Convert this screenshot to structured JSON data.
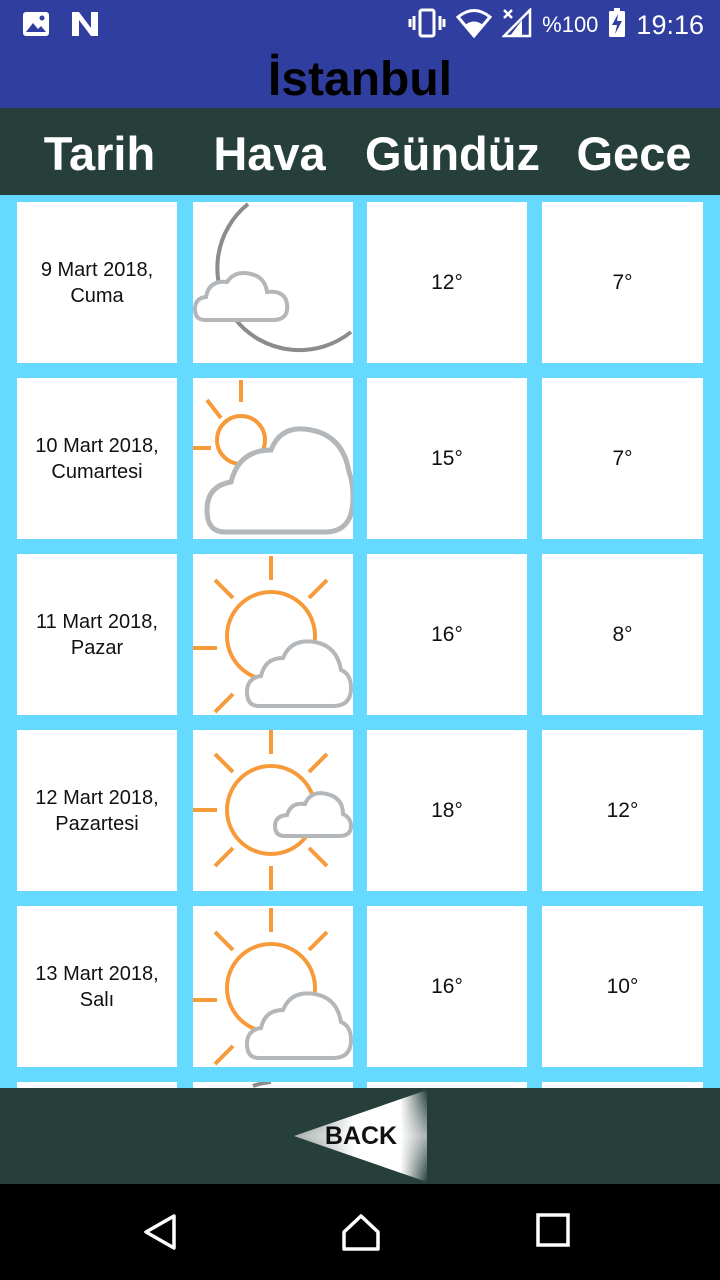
{
  "status_bar": {
    "battery": "%100",
    "time": "19:16",
    "left_icons": [
      "image-icon",
      "n-icon"
    ],
    "right_icons": [
      "vibrate-icon",
      "wifi-icon",
      "signal-icon",
      "battery-charging-icon"
    ]
  },
  "city": "İstanbul",
  "columns": [
    "Tarih",
    "Hava",
    "Gündüz",
    "Gece"
  ],
  "days": [
    {
      "date_line1": "9 Mart 2018,",
      "date_line2": "Cuma",
      "weather": "moon-cloud-icon",
      "day_temp": "12°",
      "night_temp": "7°"
    },
    {
      "date_line1": "10 Mart 2018,",
      "date_line2": "Cumartesi",
      "weather": "sun-behind-cloud-icon",
      "day_temp": "15°",
      "night_temp": "7°"
    },
    {
      "date_line1": "11 Mart 2018,",
      "date_line2": "Pazar",
      "weather": "sun-small-cloud-icon",
      "day_temp": "16°",
      "night_temp": "8°"
    },
    {
      "date_line1": "12 Mart 2018,",
      "date_line2": "Pazartesi",
      "weather": "sun-tiny-cloud-icon",
      "day_temp": "18°",
      "night_temp": "12°"
    },
    {
      "date_line1": "13 Mart 2018,",
      "date_line2": "Salı",
      "weather": "sun-small-cloud-icon",
      "day_temp": "16°",
      "night_temp": "10°"
    }
  ],
  "back_label": "BACK",
  "colors": {
    "appbar": "#303F9F",
    "header": "#273F3A",
    "grid_background": "#66D9FF",
    "sun": "#F79A3A",
    "cloud": "#B4B7BA",
    "moon": "#8C8C8C"
  },
  "nav": [
    "back-icon",
    "home-icon",
    "recents-icon"
  ]
}
